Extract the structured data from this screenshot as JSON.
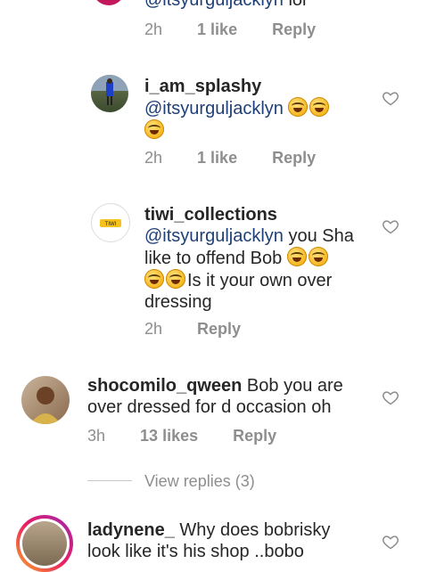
{
  "comments": [
    {
      "mention": "@itsyurguljacklyn",
      "text_after": " lol",
      "time": "2h",
      "likes": "1 like",
      "reply": "Reply"
    },
    {
      "username": "i_am_splashy",
      "mention": "@itsyurguljacklyn",
      "time": "2h",
      "likes": "1 like",
      "reply": "Reply"
    },
    {
      "username": "tiwi_collections",
      "mention": "@itsyurguljacklyn",
      "text_line1": " you Sha",
      "text_line2": "like to offend Bob",
      "text_line3": "Is it your own over",
      "text_line4": "dressing",
      "time": "2h",
      "reply": "Reply"
    },
    {
      "username": "shocomilo_qween",
      "text": " Bob you are over dressed for d occasion oh",
      "time": "3h",
      "likes": "13 likes",
      "reply": "Reply"
    },
    {
      "username": "ladynene_",
      "text": " Why does bobrisky look like it's his shop ..bobo"
    }
  ],
  "view_replies": "View replies (3)",
  "icons": {
    "like": "heart-outline-icon",
    "laugh": "rolling-laughing-emoji"
  },
  "colors": {
    "text": "#262626",
    "meta": "#8e8e8e",
    "mention": "#1f3f77"
  }
}
